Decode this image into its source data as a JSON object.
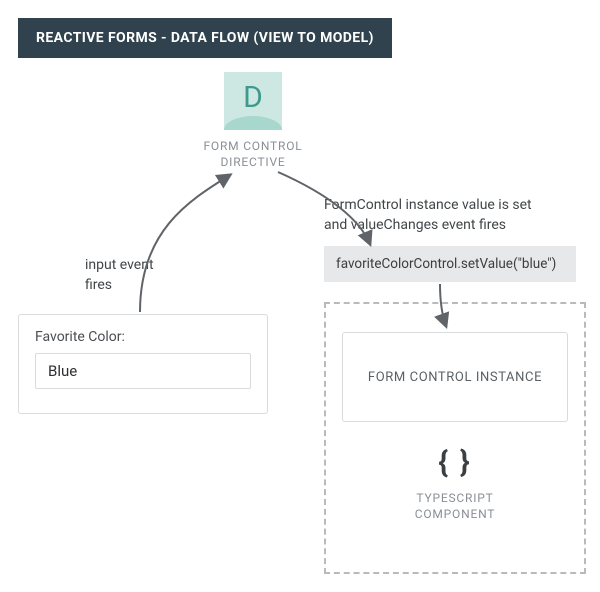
{
  "title": "REACTIVE FORMS - DATA FLOW (VIEW TO MODEL)",
  "directive": {
    "letter": "D",
    "label_line1": "FORM CONTROL",
    "label_line2": "DIRECTIVE"
  },
  "description_right_line1": "FormControl instance value is set",
  "description_right_line2": "and valueChanges event fires",
  "description_left_line1": "input event",
  "description_left_line2": "fires",
  "code_snippet": "favoriteColorControl.setValue(\"blue\")",
  "form": {
    "label": "Favorite Color:",
    "value": "Blue"
  },
  "instance_label": "FORM CONTROL INSTANCE",
  "component": {
    "braces": "{ }",
    "label_line1": "TYPESCRIPT",
    "label_line2": "COMPONENT"
  }
}
